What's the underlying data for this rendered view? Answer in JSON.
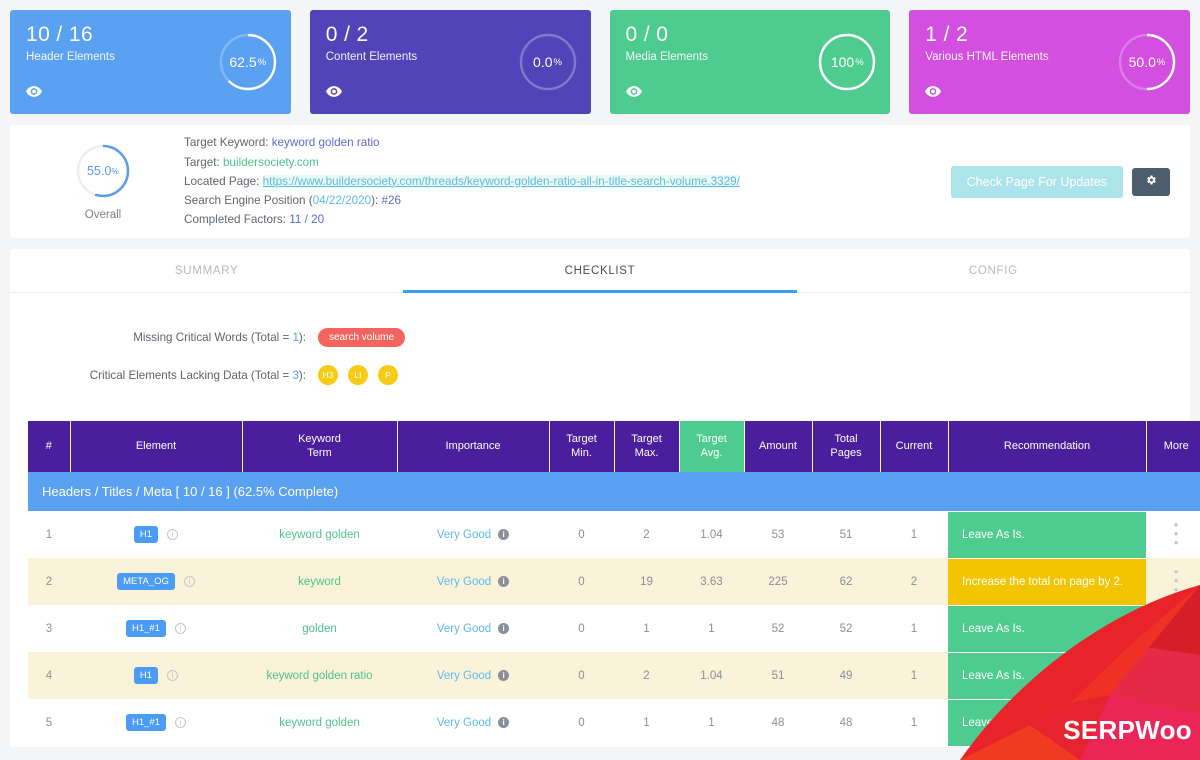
{
  "cards": [
    {
      "name": "header-elements",
      "fraction": "10 / 16",
      "label": "Header Elements",
      "percent": "62.5",
      "percent_unit": "%",
      "pct_value": 62.5,
      "color": "#5ba1f2",
      "eye_icon": "eye-icon"
    },
    {
      "name": "content-elements",
      "fraction": "0 / 2",
      "label": "Content Elements",
      "percent": "0.0",
      "percent_unit": "%",
      "pct_value": 0,
      "color": "#5143b8",
      "eye_icon": "eye-icon"
    },
    {
      "name": "media-elements",
      "fraction": "0 / 0",
      "label": "Media Elements",
      "percent": "100",
      "percent_unit": "%",
      "pct_value": 100,
      "color": "#4ecb8e",
      "eye_icon": "eye-icon"
    },
    {
      "name": "various-html-elements",
      "fraction": "1 / 2",
      "label": "Various HTML Elements",
      "percent": "50.0",
      "percent_unit": "%",
      "pct_value": 50,
      "color": "#d24fe0",
      "eye_icon": "eye-icon"
    }
  ],
  "overall": {
    "percent": "55.0",
    "percent_unit": "%",
    "pct_value": 55,
    "label": "Overall",
    "accent": "#5b9ced"
  },
  "meta": {
    "target_keyword_label": "Target Keyword:",
    "target_keyword_value": "keyword golden ratio",
    "target_label": "Target:",
    "target_value": "buildersociety.com",
    "located_page_label": "Located Page:",
    "located_page_value": "https://www.buildersociety.com/threads/keyword-golden-ratio-all-in-title-search-volume.3329/",
    "sep_label": "Search Engine Position (",
    "sep_date": "04/22/2020",
    "sep_label_close": "): ",
    "sep_value": "#26",
    "completed_label": "Completed Factors:",
    "completed_value": "11 / 20"
  },
  "actions": {
    "check_updates_label": "Check Page For Updates",
    "gear_icon": "gear-icon"
  },
  "tabs": [
    {
      "label": "SUMMARY",
      "active": false
    },
    {
      "label": "CHECKLIST",
      "active": true
    },
    {
      "label": "CONFIG",
      "active": false
    }
  ],
  "criticals": {
    "missing_words_label_pre": "Missing Critical Words (Total = ",
    "missing_words_total": "1",
    "missing_words_label_post": "):",
    "missing_words": [
      "search volume"
    ],
    "lacking_data_label_pre": "Critical Elements Lacking Data (Total = ",
    "lacking_data_total": "3",
    "lacking_data_label_post": "):",
    "lacking_data": [
      "H3",
      "LI",
      "P"
    ]
  },
  "table": {
    "headers": [
      "#",
      "Element",
      "Keyword Term",
      "Importance",
      "Target Min.",
      "Target Max.",
      "Target Avg.",
      "Amount",
      "Total Pages",
      "Current",
      "Recommendation",
      "More"
    ],
    "highlight_header_index": 6,
    "section": {
      "title": "Headers / Titles / Meta",
      "count": "[ 10 / 16 ]",
      "complete": "(62.5% Complete)"
    },
    "rows": [
      {
        "num": "1",
        "element": "H1",
        "keyword": "keyword golden",
        "importance": "Very Good",
        "target_min": "0",
        "target_max": "2",
        "target_avg": "1.04",
        "amount": "53",
        "total_pages": "51",
        "current": "1",
        "recommendation": "Leave As Is.",
        "rec_status": "good",
        "alt": false
      },
      {
        "num": "2",
        "element": "META_OG",
        "keyword": "keyword",
        "importance": "Very Good",
        "target_min": "0",
        "target_max": "19",
        "target_avg": "3.63",
        "amount": "225",
        "total_pages": "62",
        "current": "2",
        "recommendation": "Increase the total on page by 2.",
        "rec_status": "warn",
        "alt": true
      },
      {
        "num": "3",
        "element": "H1_#1",
        "keyword": "golden",
        "importance": "Very Good",
        "target_min": "0",
        "target_max": "1",
        "target_avg": "1",
        "amount": "52",
        "total_pages": "52",
        "current": "1",
        "recommendation": "Leave As Is.",
        "rec_status": "good",
        "alt": false
      },
      {
        "num": "4",
        "element": "H1",
        "keyword": "keyword golden ratio",
        "importance": "Very Good",
        "target_min": "0",
        "target_max": "2",
        "target_avg": "1.04",
        "amount": "51",
        "total_pages": "49",
        "current": "1",
        "recommendation": "Leave As Is.",
        "rec_status": "good",
        "alt": true
      },
      {
        "num": "5",
        "element": "H1_#1",
        "keyword": "keyword golden",
        "importance": "Very Good",
        "target_min": "0",
        "target_max": "1",
        "target_avg": "1",
        "amount": "48",
        "total_pages": "48",
        "current": "1",
        "recommendation": "Leave As Is.",
        "rec_status": "good",
        "alt": false
      }
    ]
  },
  "watermark": {
    "text": "SERPWoo",
    "color": "#e8232a"
  }
}
